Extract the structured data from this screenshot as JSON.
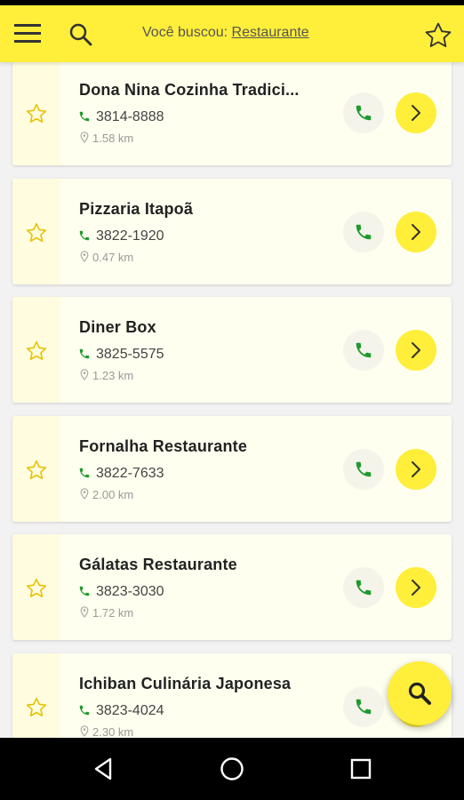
{
  "header": {
    "prefix": "Você buscou:",
    "term": "Restaurante"
  },
  "icons": {
    "menu": "menu-icon",
    "search": "search-icon",
    "favorite": "star-outline-icon",
    "phone": "phone-icon",
    "location": "location-pin-icon",
    "chevron": "chevron-right-icon"
  },
  "colors": {
    "accent": "#ffee3a",
    "phone_green": "#1f9a2e",
    "star_yellow": "#e8c200"
  },
  "results": [
    {
      "name": "Dona Nina Cozinha Tradici...",
      "phone": "3814-8888",
      "distance": "1.58 km"
    },
    {
      "name": "Pizzaria Itapoã",
      "phone": "3822-1920",
      "distance": "0.47 km"
    },
    {
      "name": "Diner Box",
      "phone": "3825-5575",
      "distance": "1.23 km"
    },
    {
      "name": "Fornalha Restaurante",
      "phone": "3822-7633",
      "distance": "2.00 km"
    },
    {
      "name": "Gálatas Restaurante",
      "phone": "3823-3030",
      "distance": "1.72 km"
    },
    {
      "name": "Ichiban Culinária Japonesa",
      "phone": "3823-4024",
      "distance": "2.30 km"
    }
  ]
}
